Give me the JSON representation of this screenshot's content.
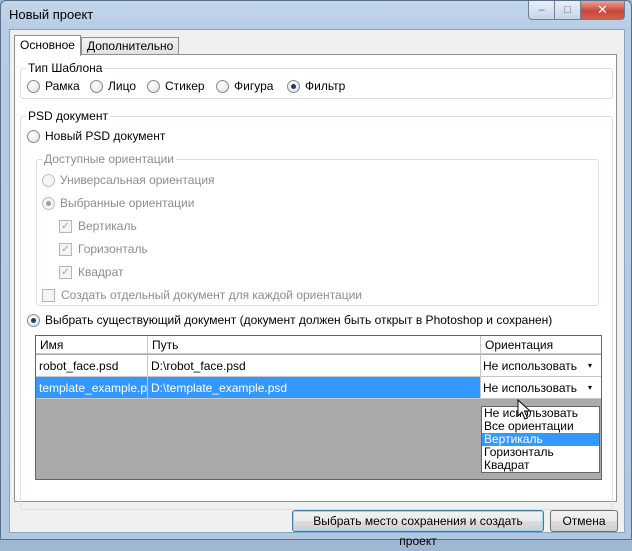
{
  "window": {
    "title": "Новый проект"
  },
  "tabs": [
    {
      "label": "Основное",
      "active": true
    },
    {
      "label": "Дополнительно",
      "active": false
    }
  ],
  "template_type": {
    "label": "Тип Шаблона",
    "options": [
      "Рамка",
      "Лицо",
      "Стикер",
      "Фигура",
      "Фильтр"
    ],
    "selected": "Фильтр"
  },
  "psd": {
    "label": "PSD документ",
    "new_doc_label": "Новый PSD документ",
    "orientations": {
      "label": "Доступные ориентации",
      "universal_label": "Универсальная ориентация",
      "selected_label": "Выбранные ориентации",
      "vertical_label": "Вертикаль",
      "horizontal_label": "Горизонталь",
      "square_label": "Квадрат",
      "separate_doc_label": "Создать отдельный документ для каждой ориентации"
    },
    "existing_doc_label": "Выбрать существующий документ (документ должен быть открыт в Photoshop и сохранен)"
  },
  "grid": {
    "columns": [
      "Имя",
      "Путь",
      "Ориентация"
    ],
    "rows": [
      {
        "name": "robot_face.psd",
        "path": "D:\\robot_face.psd",
        "orientation": "Не использовать"
      },
      {
        "name": "template_example.psd",
        "path": "D:\\template_example.psd",
        "orientation": "Не использовать"
      }
    ],
    "dropdown_options": [
      "Не использовать",
      "Все ориентации",
      "Вертикаль",
      "Горизонталь",
      "Квадрат"
    ],
    "highlighted_option": "Вертикаль"
  },
  "buttons": {
    "create_label": "Выбрать место сохранения и создать проект",
    "cancel_label": "Отмена"
  },
  "icons": {
    "combo_arrow": "▾",
    "check": "✓",
    "minimize": "–",
    "maximize": "□",
    "close": "✕"
  },
  "colors": {
    "selection": "#3399ff",
    "grid_background": "#aaaaaa"
  }
}
